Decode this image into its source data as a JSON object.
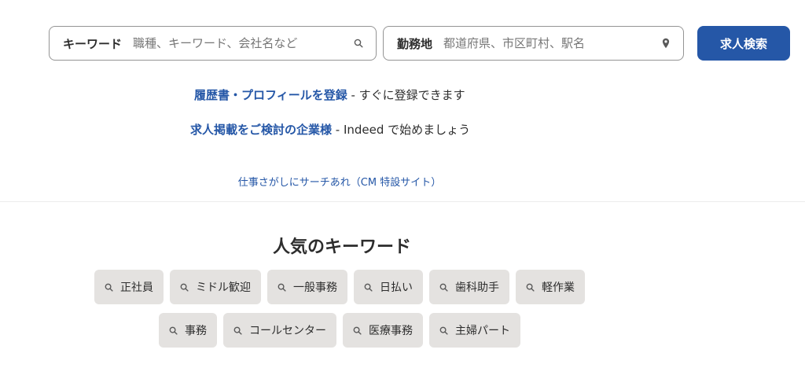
{
  "search": {
    "what_label": "キーワード",
    "what_placeholder": "職種、キーワード、会社名など",
    "where_label": "勤務地",
    "where_placeholder": "都道府県、市区町村、駅名",
    "button_label": "求人検索"
  },
  "promos": [
    {
      "link": "履歴書・プロフィールを登録",
      "text": " - すぐに登録できます"
    },
    {
      "link": "求人掲載をご検討の企業様",
      "text": " - Indeed で始めましょう"
    }
  ],
  "cm_link": "仕事さがしにサーチあれ（CM 特設サイト）",
  "popular": {
    "title": "人気のキーワード",
    "row1": [
      "正社員",
      "ミドル歓迎",
      "一般事務",
      "日払い",
      "歯科助手",
      "軽作業"
    ],
    "row2": [
      "事務",
      "コールセンター",
      "医療事務",
      "主婦パート"
    ]
  },
  "colors": {
    "accent": "#2557a7",
    "chip_bg": "#e4e2e0",
    "text": "#2d2d2d",
    "placeholder": "#767676"
  },
  "icons": {
    "what_field": "search-icon",
    "where_field": "location-pin-icon",
    "chip": "search-icon"
  }
}
